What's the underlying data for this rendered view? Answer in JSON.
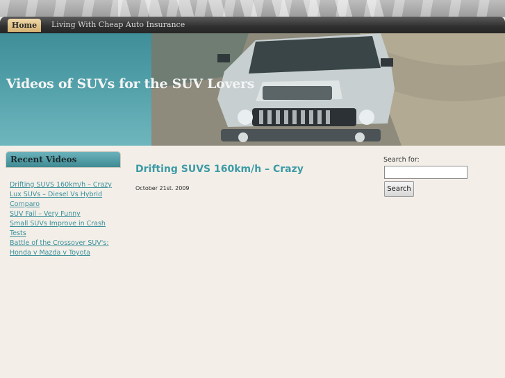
{
  "nav": {
    "home_label": "Home",
    "link_label": "Living With Cheap Auto Insurance"
  },
  "header": {
    "site_title": "Videos of SUVs for the SUV Lovers"
  },
  "sidebar": {
    "widget_title": "Recent Videos",
    "items": [
      {
        "label": "Drifting SUVS 160km/h – Crazy"
      },
      {
        "label": "Lux SUVs – Diesel Vs Hybrid Comparo"
      },
      {
        "label": "SUV Fail – Very Funny"
      },
      {
        "label": "Small SUVs Improve in Crash Tests"
      },
      {
        "label": "Battle of the Crossover SUV's: Honda v Mazda v Toyota"
      }
    ]
  },
  "post": {
    "title": "Drifting SUVS 160km/h – Crazy",
    "date": "October 21st. 2009"
  },
  "search": {
    "label": "Search for:",
    "value": "",
    "button_label": "Search"
  },
  "colors": {
    "accent": "#3d9aa6",
    "background": "#f3efe8",
    "nav_home": "#e4c68e"
  }
}
